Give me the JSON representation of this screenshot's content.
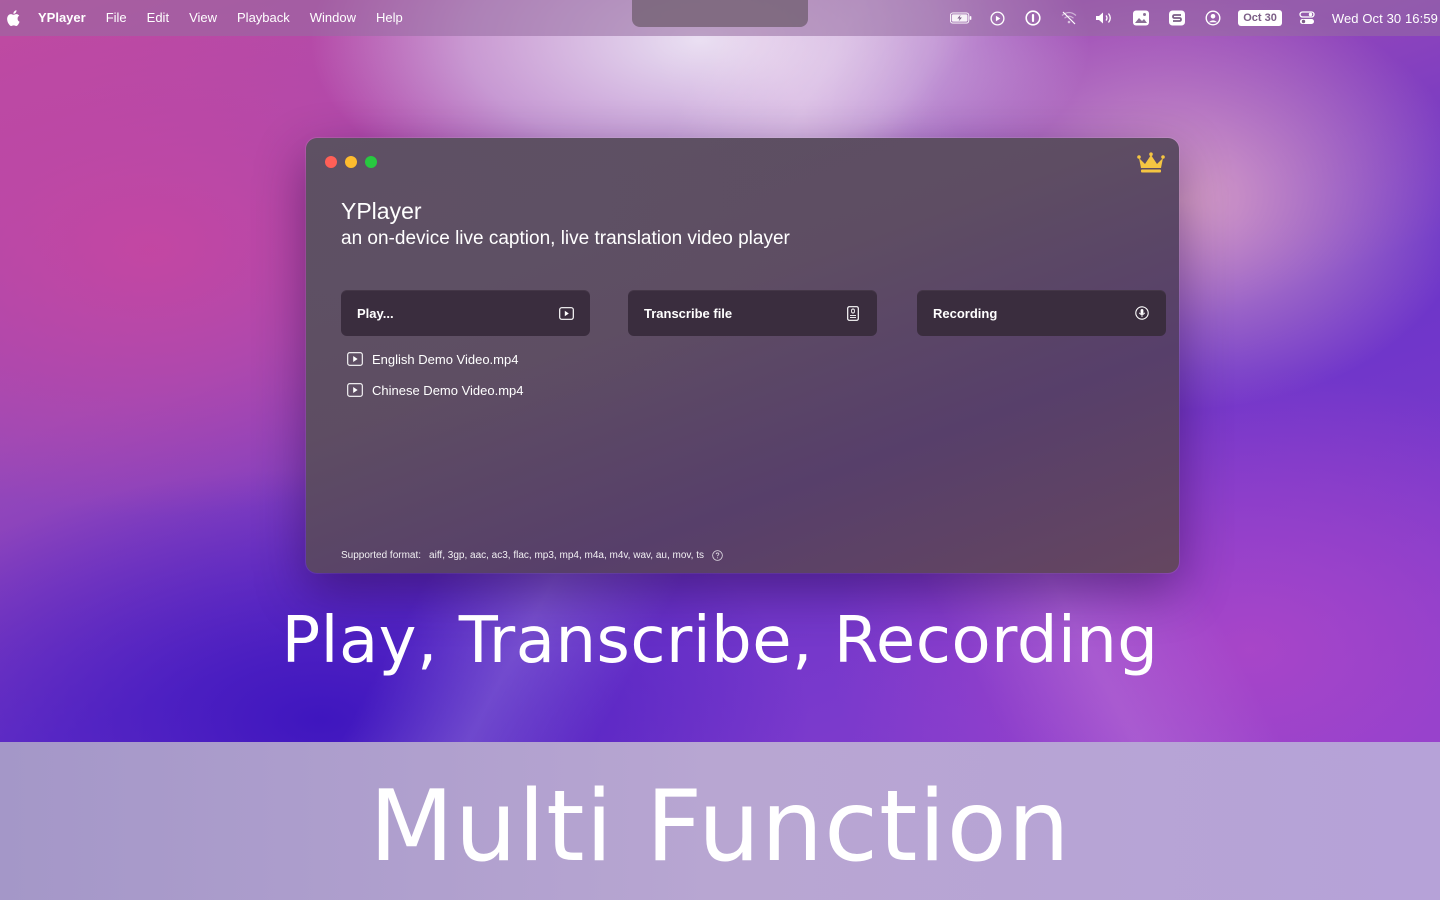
{
  "menubar": {
    "app_name": "YPlayer",
    "items": [
      "File",
      "Edit",
      "View",
      "Playback",
      "Window",
      "Help"
    ],
    "date_badge": "Oct 30",
    "clock": "Wed Oct 30  16:59"
  },
  "window": {
    "title": "YPlayer",
    "subtitle": "an on-device live caption, live translation video player",
    "buttons": {
      "play": "Play...",
      "transcribe": "Transcribe file",
      "recording": "Recording"
    },
    "recent_files": [
      "English Demo Video.mp4",
      "Chinese Demo Video.mp4"
    ],
    "footer": {
      "label": "Supported format:",
      "formats": "aiff, 3gp, aac, ac3, flac, mp3, mp4, m4a, m4v, wav, au, mov, ts"
    }
  },
  "captions": {
    "main": "Play, Transcribe, Recording",
    "bottom": "Multi Function"
  },
  "colors": {
    "close": "#ff5f57",
    "minimize": "#febc2e",
    "maximize": "#28c840",
    "crown": "#f5c542",
    "button_bg": "#3a2d3e"
  }
}
